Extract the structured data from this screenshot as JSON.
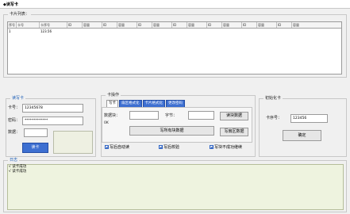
{
  "window": {
    "title": "◆读写卡"
  },
  "card_list": {
    "title": "卡片列表：",
    "columns": [
      "序号",
      "卡号",
      "卡序号",
      "ID",
      "容量",
      "ID",
      "容量",
      "ID",
      "容量",
      "ID",
      "容量",
      "ID",
      "容量",
      "ID",
      "容量",
      "ID",
      "容量"
    ],
    "rows": [
      [
        "1",
        "",
        "123.56",
        "",
        "",
        "",
        "",
        "",
        "",
        "",
        "",
        "",
        "",
        "",
        "",
        "",
        ""
      ]
    ]
  },
  "reader": {
    "title": "读写卡",
    "fields": [
      {
        "label": "卡号：",
        "value": "12345678"
      },
      {
        "label": "密码：",
        "value": "*************"
      },
      {
        "label": "数据：",
        "value": ""
      }
    ],
    "read_button": "读卡"
  },
  "card_ops": {
    "title": "卡操作",
    "tabs": [
      "写卡",
      "扇区格式化",
      "卡片格式化",
      "更改密码"
    ],
    "field_a_label": "数据块：",
    "field_b_label": "字节：",
    "note": "0K",
    "btn_read": "读块数据",
    "btn_write_all": "写所有块数据",
    "btn_write_sector": "写扇区数据",
    "checks": [
      "写后自动读",
      "写后校验",
      "写块不成功继续"
    ]
  },
  "init": {
    "title": "初始化卡",
    "label": "卡序号：",
    "value": "123456",
    "button": "确定"
  },
  "log": {
    "title": "日志",
    "lines": [
      "√ 读卡成功",
      "√ 读卡成功"
    ]
  }
}
